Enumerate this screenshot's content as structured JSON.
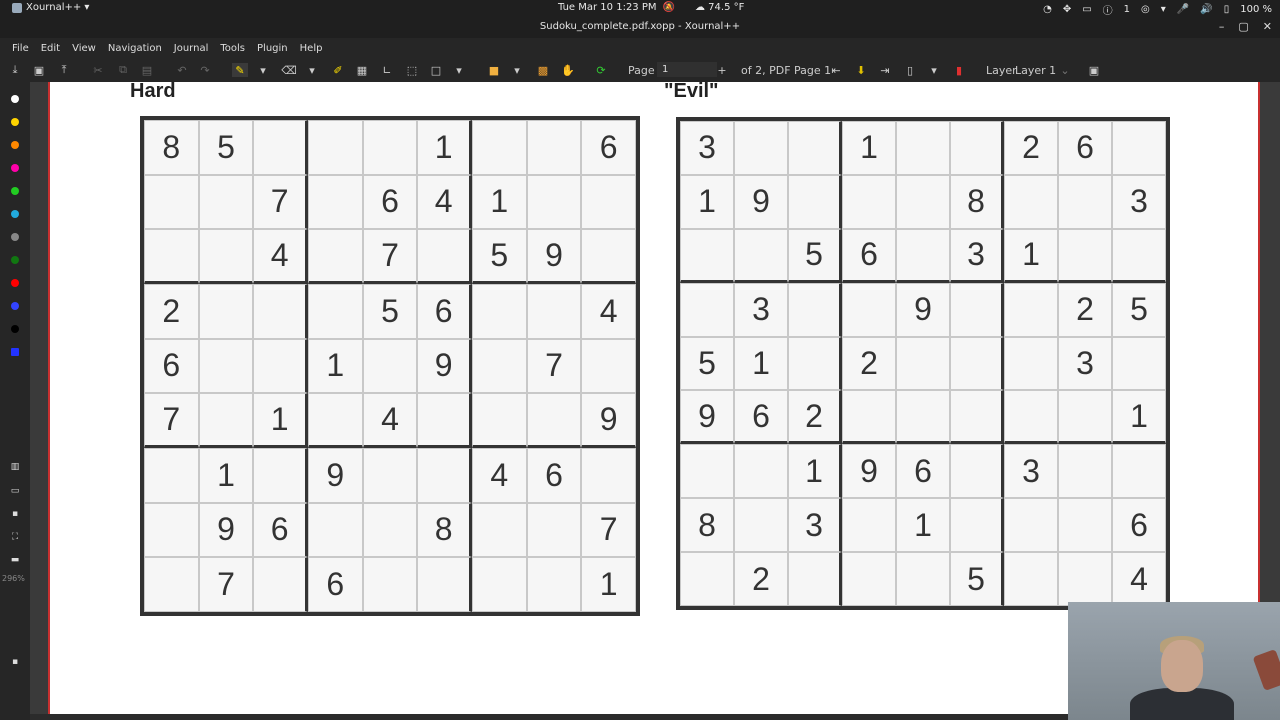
{
  "topbar": {
    "app_name": "Xournal++ ▾",
    "clock": "Tue Mar 10  1:23 PM",
    "weather": "☁ 74.5 °F",
    "notification_count": "1",
    "battery": "100 %"
  },
  "window": {
    "title": "Sudoku_complete.pdf.xopp - Xournal++"
  },
  "menu": [
    "File",
    "Edit",
    "View",
    "Navigation",
    "Journal",
    "Tools",
    "Plugin",
    "Help"
  ],
  "toolbar": {
    "page_label": "Page",
    "page_value": "1",
    "page_of": "of 2, PDF Page 1",
    "layer_label": "Layer",
    "layer_value": "Layer 1"
  },
  "sidebar": {
    "zoom": "296%",
    "colors": [
      "#ffffff",
      "#ffd400",
      "#ff8800",
      "#ff00aa",
      "#22cc22",
      "#22aadd",
      "#888888",
      "#117711",
      "#ff0000",
      "#3344ff",
      "#000000",
      "#2233ff"
    ]
  },
  "puzzles": [
    {
      "title": "Hard",
      "grid": [
        [
          "8",
          "5",
          "",
          "",
          "",
          "1",
          "",
          "",
          "6"
        ],
        [
          "",
          "",
          "7",
          "",
          "6",
          "4",
          "1",
          "",
          ""
        ],
        [
          "",
          "",
          "4",
          "",
          "7",
          "",
          "5",
          "9",
          ""
        ],
        [
          "2",
          "",
          "",
          "",
          "5",
          "6",
          "",
          "",
          "4"
        ],
        [
          "6",
          "",
          "",
          "1",
          "",
          "9",
          "",
          "7",
          ""
        ],
        [
          "7",
          "",
          "1",
          "",
          "4",
          "",
          "",
          "",
          "9"
        ],
        [
          "",
          "1",
          "",
          "9",
          "",
          "",
          "4",
          "6",
          ""
        ],
        [
          "",
          "9",
          "6",
          "",
          "",
          "8",
          "",
          "",
          "7"
        ],
        [
          "",
          "7",
          "",
          "6",
          "",
          "",
          "",
          "",
          "1"
        ]
      ]
    },
    {
      "title": "\"Evil\"",
      "grid": [
        [
          "3",
          "",
          "",
          "1",
          "",
          "",
          "2",
          "6",
          ""
        ],
        [
          "1",
          "9",
          "",
          "",
          "",
          "8",
          "",
          "",
          "3"
        ],
        [
          "",
          "",
          "5",
          "6",
          "",
          "3",
          "1",
          "",
          ""
        ],
        [
          "",
          "3",
          "",
          "",
          "9",
          "",
          "",
          "2",
          "5"
        ],
        [
          "5",
          "1",
          "",
          "2",
          "",
          "",
          "",
          "3",
          ""
        ],
        [
          "9",
          "6",
          "2",
          "",
          "",
          "",
          "",
          "",
          "1"
        ],
        [
          "",
          "",
          "1",
          "9",
          "6",
          "",
          "3",
          "",
          ""
        ],
        [
          "8",
          "",
          "3",
          "",
          "1",
          "",
          "",
          "",
          "6"
        ],
        [
          "",
          "2",
          "",
          "",
          "",
          "5",
          "",
          "",
          "4"
        ]
      ]
    }
  ]
}
